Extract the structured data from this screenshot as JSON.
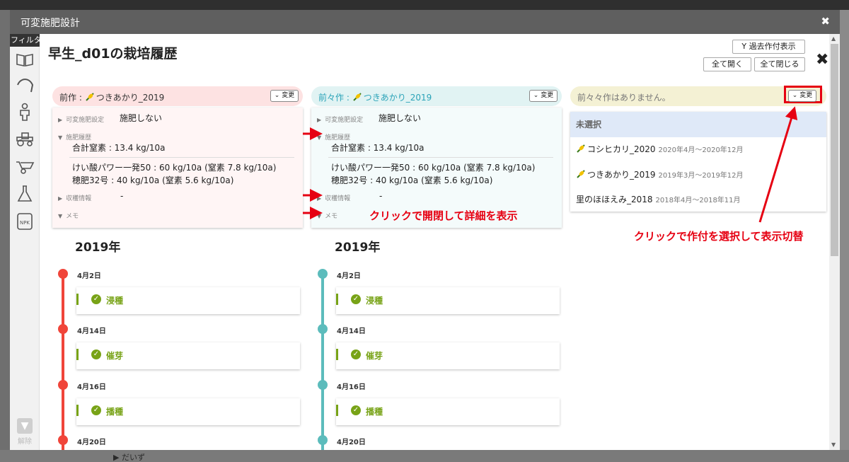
{
  "background": {
    "bottom_text": "▶ だいず"
  },
  "modal": {
    "title": "可変施肥設計",
    "close_symbol": "✖"
  },
  "iconbar": {
    "filter_label": "フィルタ",
    "icons": [
      "book-icon",
      "sickle-icon",
      "person-icon",
      "tractor-icon",
      "wheelbarrow-icon",
      "flask-icon",
      "npk-bag-icon"
    ],
    "release_label": "解除",
    "release_icon": "funnel-icon"
  },
  "page": {
    "title": "早生_d01の栽培履歴",
    "past_button": "過去作付表示",
    "open_all": "全て開く",
    "close_all": "全て閉じる",
    "close_symbol": "✖"
  },
  "columns": [
    {
      "label": "前作 : ",
      "crop": "つきあかり_2019",
      "change_button": "⌄ 変更",
      "variable_label": "可変施肥設定",
      "variable_value": "施肥しない",
      "fert_label": "施肥履歴",
      "total": "合計窒素 : 13.4 kg/10a",
      "line1": "けい酸パワー一発50 : 60 kg/10a (窒素 7.8 kg/10a)",
      "line2": "穂肥32号 : 40 kg/10a (窒素 5.6 kg/10a)",
      "harvest_label": "収穫情報",
      "harvest_value": "-",
      "memo_label": "メモ",
      "year": "2019年",
      "events": [
        {
          "date": "4月2日",
          "name": "浸種"
        },
        {
          "date": "4月14日",
          "name": "催芽"
        },
        {
          "date": "4月16日",
          "name": "播種"
        },
        {
          "date": "4月20日",
          "name": ""
        }
      ]
    },
    {
      "label": "前々作 : ",
      "crop": "つきあかり_2019",
      "change_button": "⌄ 変更",
      "variable_label": "可変施肥設定",
      "variable_value": "施肥しない",
      "fert_label": "施肥履歴",
      "total": "合計窒素 : 13.4 kg/10a",
      "line1": "けい酸パワー一発50 : 60 kg/10a (窒素 7.8 kg/10a)",
      "line2": "穂肥32号 : 40 kg/10a (窒素 5.6 kg/10a)",
      "harvest_label": "収穫情報",
      "harvest_value": "-",
      "memo_label": "メモ",
      "year": "2019年",
      "events": [
        {
          "date": "4月2日",
          "name": "浸種"
        },
        {
          "date": "4月14日",
          "name": "催芽"
        },
        {
          "date": "4月16日",
          "name": "播種"
        },
        {
          "date": "4月20日",
          "name": ""
        }
      ]
    }
  ],
  "third": {
    "label": "前々々作はありません。",
    "change_button": "⌄ 変更",
    "options": [
      {
        "name": "未選択",
        "range": ""
      },
      {
        "name": "コシヒカリ_2020",
        "range": "2020年4月～2020年12月"
      },
      {
        "name": "つきあかり_2019",
        "range": "2019年3月～2019年12月"
      },
      {
        "name": "里のほほえみ_2018",
        "range": "2018年4月～2018年11月"
      }
    ]
  },
  "annotations": {
    "toggle_note": "クリックで開閉して詳細を表示",
    "select_note": "クリックで作付を選択して表示切替"
  },
  "colors": {
    "col1_head": "#fde2e2",
    "col1_panel": "#fff5f5",
    "col1_line": "#f0453a",
    "col2_head": "#e1f3f3",
    "col2_panel": "#f4fbfb",
    "col2_line": "#5cbcbc",
    "col2_crop": "#2aa3b8",
    "col3_head": "#f4f1d4",
    "event_green": "#78a317",
    "annotation_red": "#e60012"
  }
}
